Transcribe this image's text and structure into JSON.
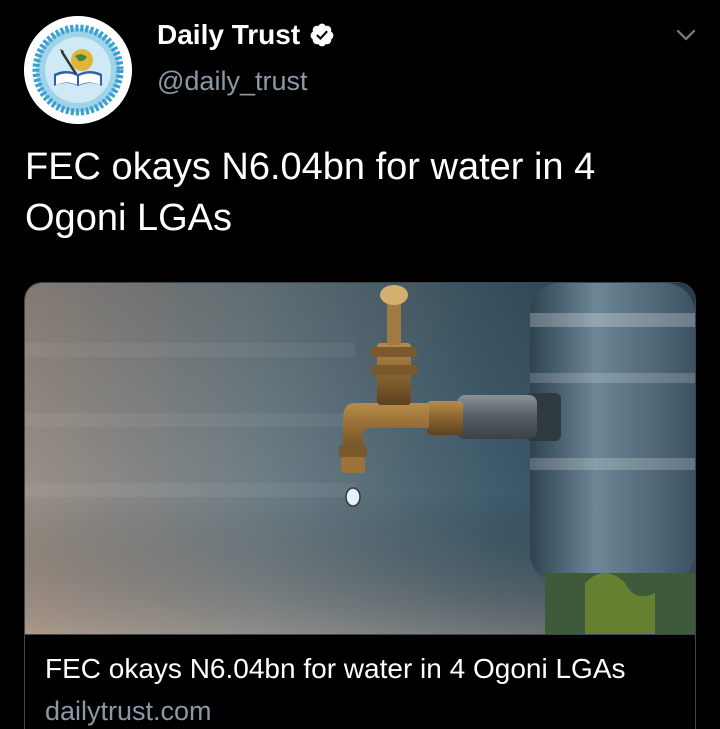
{
  "author": {
    "display_name": "Daily Trust",
    "handle": "@daily_trust",
    "verified": true,
    "avatar_icon": "daily-trust-logo-icon"
  },
  "menu": {
    "icon": "chevron-down-icon"
  },
  "tweet": {
    "text": "FEC okays N6.04bn for water in 4 Ogoni LGAs"
  },
  "card": {
    "image_icon": "water-tap-photo",
    "title": "FEC okays N6.04bn for water in 4 Ogoni LGAs",
    "domain": "dailytrust.com"
  },
  "colors": {
    "background": "#000000",
    "text_primary": "#ffffff",
    "text_secondary": "#8b98a5",
    "card_border": "#3c4650",
    "verified_badge": "#ffffff"
  }
}
